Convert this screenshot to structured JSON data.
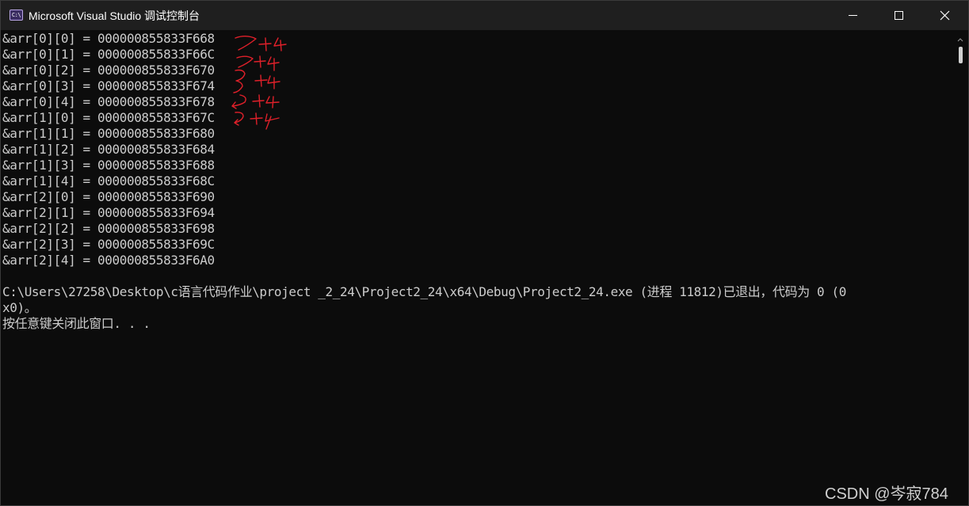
{
  "window": {
    "title": "Microsoft Visual Studio 调试控制台",
    "app_icon_text": "C:\\",
    "buttons": [
      "minimize",
      "maximize",
      "close"
    ]
  },
  "console": {
    "lines": [
      "&arr[0][0] = 000000855833F668",
      "&arr[0][1] = 000000855833F66C",
      "&arr[0][2] = 000000855833F670",
      "&arr[0][3] = 000000855833F674",
      "&arr[0][4] = 000000855833F678",
      "&arr[1][0] = 000000855833F67C",
      "&arr[1][1] = 000000855833F680",
      "&arr[1][2] = 000000855833F684",
      "&arr[1][3] = 000000855833F688",
      "&arr[1][4] = 000000855833F68C",
      "&arr[2][0] = 000000855833F690",
      "&arr[2][1] = 000000855833F694",
      "&arr[2][2] = 000000855833F698",
      "&arr[2][3] = 000000855833F69C",
      "&arr[2][4] = 000000855833F6A0",
      "",
      "C:\\Users\\27258\\Desktop\\c语言代码作业\\project _2_24\\Project2_24\\x64\\Debug\\Project2_24.exe (进程 11812)已退出，代码为 0 (0",
      "x0)。",
      "按任意键关闭此窗口. . ."
    ]
  },
  "annotation": {
    "color": "#e0202a",
    "marks": [
      "+4",
      "+4",
      "+4",
      "+4",
      "+4"
    ]
  },
  "watermark": "CSDN @岑寂784",
  "colors": {
    "console_bg": "#0c0c0c",
    "console_text": "#cccccc",
    "titlebar_bg": "#1f1f1f"
  }
}
